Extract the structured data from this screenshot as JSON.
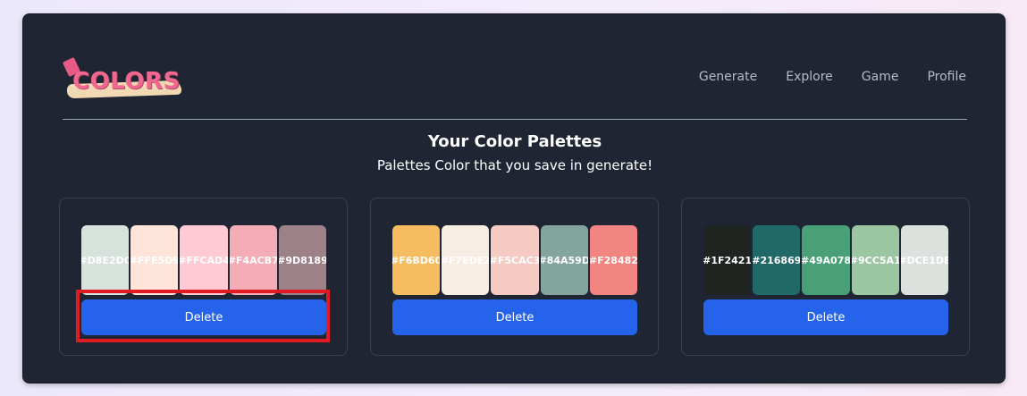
{
  "brand": {
    "logo_text": "COLORS",
    "accent": "#f0678f"
  },
  "nav": {
    "items": [
      {
        "label": "Generate"
      },
      {
        "label": "Explore"
      },
      {
        "label": "Game"
      },
      {
        "label": "Profile"
      }
    ]
  },
  "header": {
    "title": "Your Color Palettes",
    "subtitle": "Palettes Color that you save in generate!"
  },
  "palettes": [
    {
      "colors": [
        "#D8E2DC",
        "#FFE5D9",
        "#FFCAD4",
        "#F4ACB7",
        "#9D8189"
      ],
      "labels": [
        "#D8E2DC",
        "#FFE5D9",
        "#FFCAD4",
        "#F4ACB7",
        "#9D8189"
      ],
      "delete_label": "Delete"
    },
    {
      "colors": [
        "#F6BD60",
        "#F7EDE2",
        "#F5CAC3",
        "#84A59D",
        "#F28482"
      ],
      "labels": [
        "#F6BD60",
        "#F7EDE2",
        "#F5CAC3",
        "#84A59D",
        "#F28482"
      ],
      "delete_label": "Delete"
    },
    {
      "colors": [
        "#1F2421",
        "#216869",
        "#49A078",
        "#9CC5A1",
        "#DCE1DE"
      ],
      "labels": [
        "#1F2421",
        "#216869",
        "#49A078",
        "#9CC5A1",
        "#DCE1DE"
      ],
      "delete_label": "Delete"
    }
  ],
  "theme": {
    "background": "#1f2532",
    "button": "#2563eb",
    "highlight": "#e01b24"
  }
}
